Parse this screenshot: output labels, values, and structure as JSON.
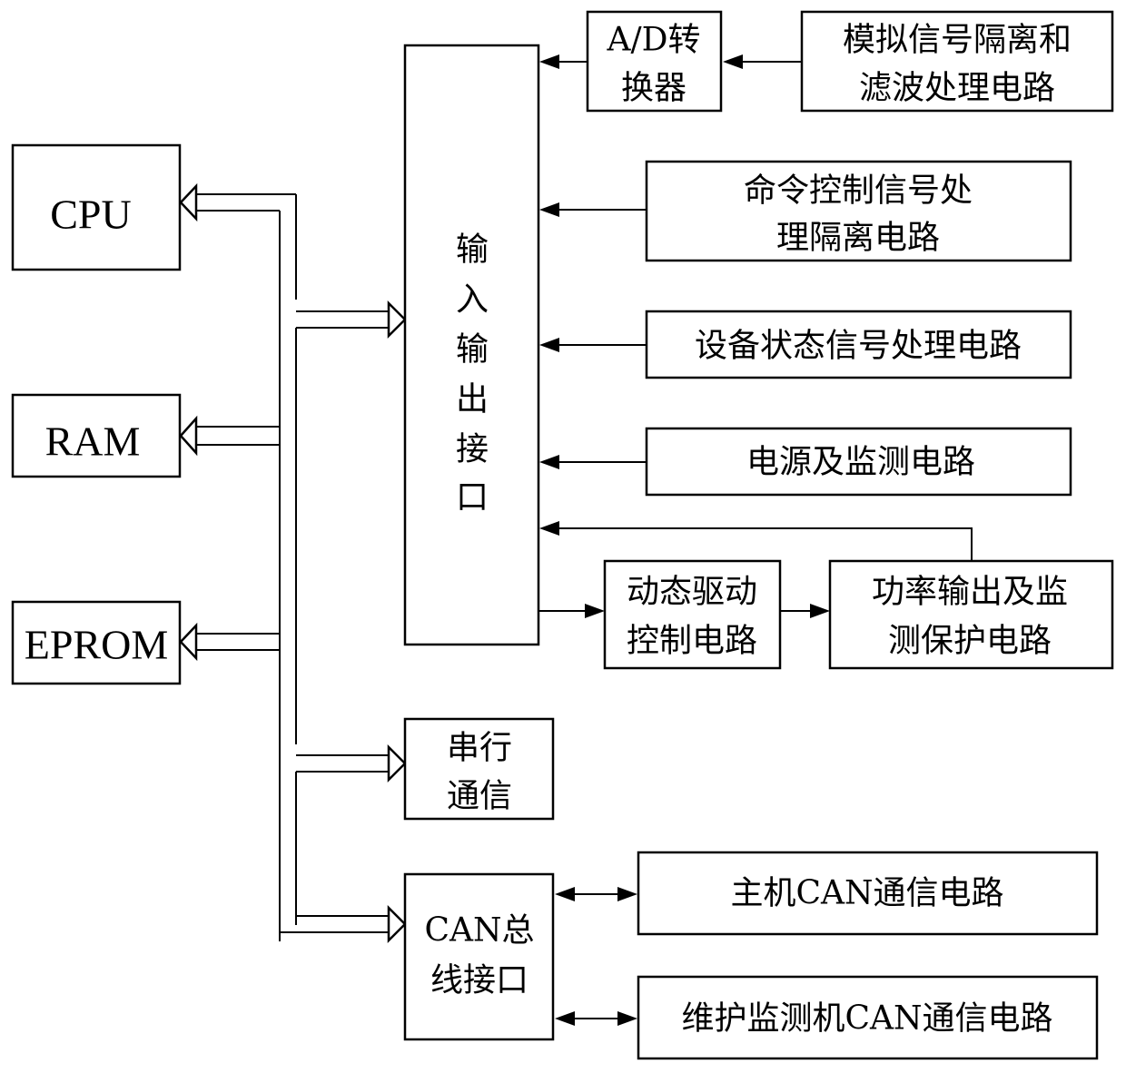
{
  "diagram": {
    "blocks": {
      "cpu": {
        "lines": [
          "CPU"
        ]
      },
      "ram": {
        "lines": [
          "RAM"
        ]
      },
      "eprom": {
        "lines": [
          "EPROM"
        ]
      },
      "io": {
        "lines": [
          "输",
          "入",
          "输",
          "出",
          "接",
          "口"
        ]
      },
      "serial": {
        "lines": [
          "串行",
          "通信"
        ]
      },
      "can": {
        "lines": [
          "CAN总",
          "线接口"
        ]
      },
      "adc": {
        "lines": [
          "A/D转",
          "换器"
        ]
      },
      "analog": {
        "lines": [
          "模拟信号隔离和",
          "滤波处理电路"
        ]
      },
      "cmd": {
        "lines": [
          "命令控制信号处",
          "理隔离电路"
        ]
      },
      "status": {
        "lines": [
          "设备状态信号处理电路"
        ]
      },
      "power": {
        "lines": [
          "电源及监测电路"
        ]
      },
      "drive": {
        "lines": [
          "动态驱动",
          "控制电路"
        ]
      },
      "output": {
        "lines": [
          "功率输出及监",
          "测保护电路"
        ]
      },
      "host": {
        "lines": [
          "主机CAN通信电路"
        ]
      },
      "maint": {
        "lines": [
          "维护监测机CAN通信电路"
        ]
      }
    },
    "connections": [
      {
        "from": "analog",
        "to": "adc",
        "type": "arrow"
      },
      {
        "from": "adc",
        "to": "io",
        "type": "arrow"
      },
      {
        "from": "cmd",
        "to": "io",
        "type": "arrow"
      },
      {
        "from": "status",
        "to": "io",
        "type": "arrow"
      },
      {
        "from": "power",
        "to": "io",
        "type": "arrow"
      },
      {
        "from": "output",
        "to": "io",
        "type": "arrow"
      },
      {
        "from": "io",
        "to": "drive",
        "type": "arrow"
      },
      {
        "from": "drive",
        "to": "output",
        "type": "arrow"
      },
      {
        "from": "can",
        "to": "host",
        "type": "bidirectional"
      },
      {
        "from": "can",
        "to": "maint",
        "type": "bidirectional"
      },
      {
        "from": "bus",
        "to": "cpu",
        "type": "bus"
      },
      {
        "from": "bus",
        "to": "ram",
        "type": "bus"
      },
      {
        "from": "bus",
        "to": "eprom",
        "type": "bus"
      },
      {
        "from": "bus",
        "to": "io",
        "type": "bus"
      },
      {
        "from": "bus",
        "to": "serial",
        "type": "bus"
      },
      {
        "from": "bus",
        "to": "can",
        "type": "bus"
      }
    ]
  }
}
